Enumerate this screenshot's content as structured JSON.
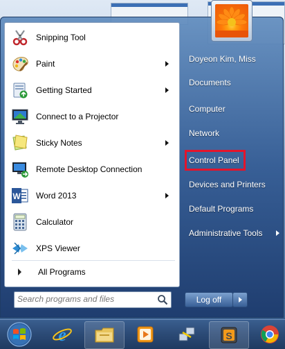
{
  "start_menu": {
    "programs": [
      {
        "label": "Snipping Tool",
        "icon": "scissors-icon",
        "has_submenu": false
      },
      {
        "label": "Paint",
        "icon": "paint-palette-icon",
        "has_submenu": true
      },
      {
        "label": "Getting Started",
        "icon": "getting-started-icon",
        "has_submenu": true
      },
      {
        "label": "Connect to a Projector",
        "icon": "projector-icon",
        "has_submenu": false
      },
      {
        "label": "Sticky Notes",
        "icon": "sticky-notes-icon",
        "has_submenu": true
      },
      {
        "label": "Remote Desktop Connection",
        "icon": "remote-desktop-icon",
        "has_submenu": false
      },
      {
        "label": "Word 2013",
        "icon": "word-icon",
        "has_submenu": true
      },
      {
        "label": "Calculator",
        "icon": "calculator-icon",
        "has_submenu": false
      },
      {
        "label": "XPS Viewer",
        "icon": "xps-viewer-icon",
        "has_submenu": false
      }
    ],
    "all_programs_label": "All Programs",
    "search_placeholder": "Search programs and files",
    "right_items": [
      {
        "label": "Doyeon Kim, Miss",
        "has_submenu": false
      },
      {
        "label": "Documents",
        "has_submenu": false
      },
      {
        "label": "Computer",
        "has_submenu": false
      },
      {
        "label": "Network",
        "has_submenu": false
      },
      {
        "label": "Control Panel",
        "has_submenu": false,
        "highlighted": true
      },
      {
        "label": "Devices and Printers",
        "has_submenu": false
      },
      {
        "label": "Default Programs",
        "has_submenu": false
      },
      {
        "label": "Administrative Tools",
        "has_submenu": true
      }
    ],
    "logoff_label": "Log off",
    "highlight_color": "#e4142b"
  },
  "taskbar": {
    "items": [
      "start-orb-icon",
      "internet-explorer-icon",
      "file-explorer-icon",
      "media-player-icon",
      "network-transfer-icon",
      "sublime-text-icon",
      "chrome-icon"
    ]
  }
}
